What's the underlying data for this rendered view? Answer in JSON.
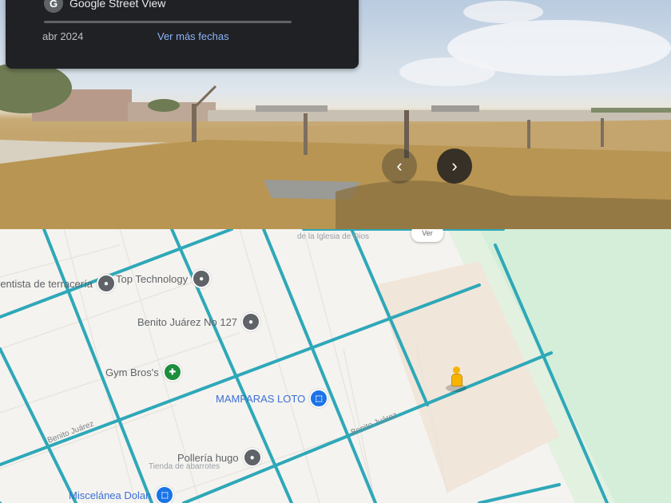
{
  "street_view": {
    "title": "Google Street View",
    "date": "abr 2024",
    "more_dates_link": "Ver más fechas",
    "nav_prev_icon": "chevron-left-icon",
    "nav_next_icon": "chevron-right-icon"
  },
  "map": {
    "pois": [
      {
        "name": "rentista de terracería",
        "icon": "place-icon",
        "color": "#5f6368"
      },
      {
        "name": "Top Technology",
        "icon": "place-icon",
        "color": "#5f6368"
      },
      {
        "name": "Benito Juárez No 127",
        "icon": "place-icon",
        "color": "#5f6368"
      },
      {
        "name": "Gym Bros's",
        "icon": "gym-icon",
        "color": "#1e8e3e"
      },
      {
        "name": "MAMPARAS LOTO",
        "icon": "shopping-icon",
        "color": "#1a73e8"
      },
      {
        "name": "Pollería hugo",
        "icon": "place-icon",
        "color": "#5f6368"
      },
      {
        "name": "Miscelánea Dolan",
        "icon": "shopping-icon",
        "color": "#1a73e8"
      }
    ],
    "poi_sublabel": "Tienda de abarrotes",
    "top_label": "de la Iglesia de Dios",
    "top_marker": "Ver",
    "streets": [
      {
        "name": "Benito Juárez"
      },
      {
        "name": "Benito Juárez"
      }
    ]
  },
  "colors": {
    "road": "#2ea8b8",
    "park": "#d4eed9",
    "street_view_card": "#202124",
    "link": "#8ab4f8"
  }
}
